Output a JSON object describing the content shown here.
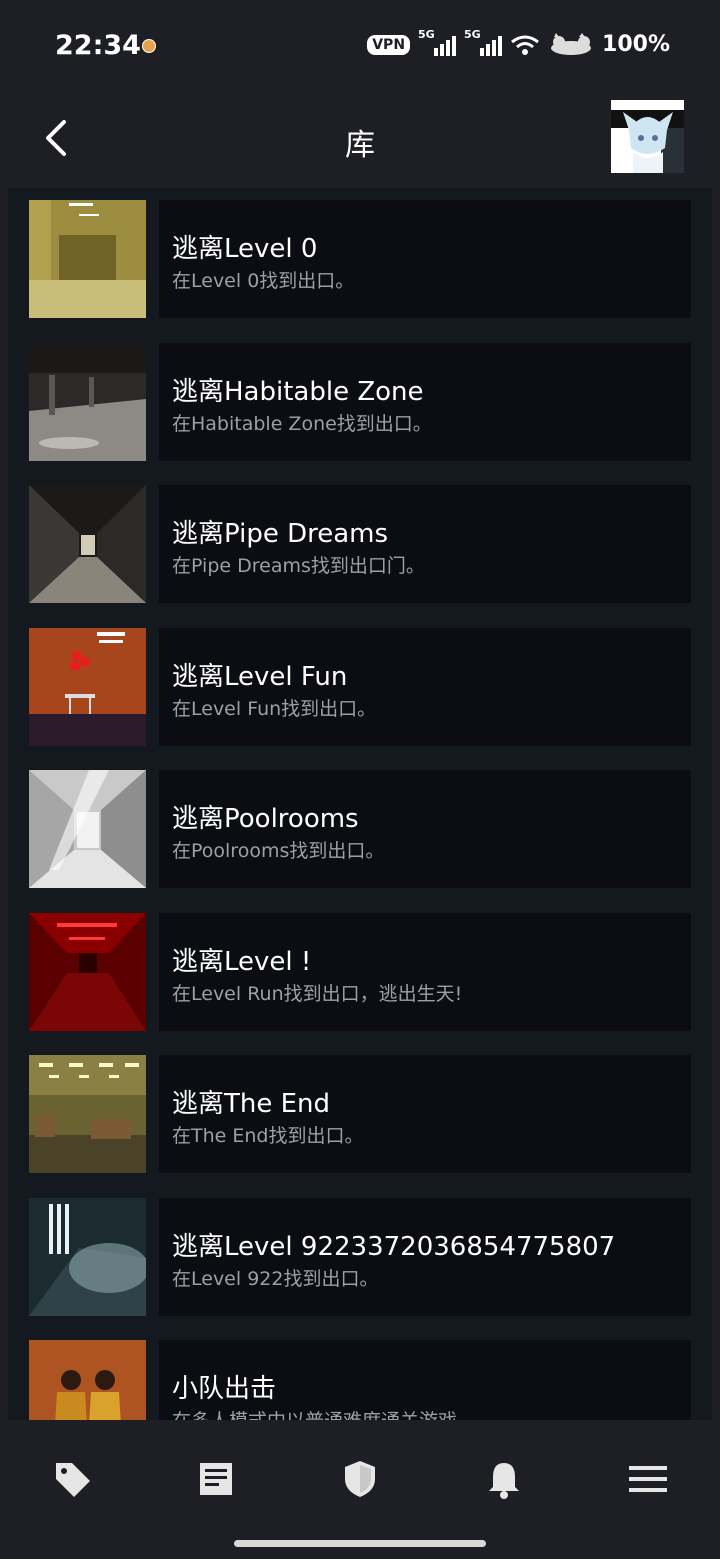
{
  "status_bar": {
    "time": "22:34",
    "vpn": "VPN",
    "network1": "5G",
    "network2": "5G",
    "battery": "100%"
  },
  "header": {
    "title": "库"
  },
  "achievements": [
    {
      "title": "逃离Level 0",
      "desc": "在Level 0找到出口。"
    },
    {
      "title": "逃离Habitable Zone",
      "desc": "在Habitable Zone找到出口。"
    },
    {
      "title": "逃离Pipe Dreams",
      "desc": "在Pipe Dreams找到出口门。"
    },
    {
      "title": "逃离Level Fun",
      "desc": "在Level Fun找到出口。"
    },
    {
      "title": "逃离Poolrooms",
      "desc": "在Poolrooms找到出口。"
    },
    {
      "title": "逃离Level !",
      "desc": "在Level Run找到出口，逃出生天!"
    },
    {
      "title": "逃离The End",
      "desc": "在The End找到出口。"
    },
    {
      "title": "逃离Level 9223372036854775807",
      "desc": "在Level 922找到出口。"
    },
    {
      "title": "小队出击",
      "desc": "在多人模式中以普通难度通关游戏"
    }
  ],
  "bottom_nav": {
    "icons": [
      "tag-icon",
      "news-icon",
      "shield-icon",
      "bell-icon",
      "menu-icon"
    ]
  },
  "colors": {
    "background": "#1d1f25",
    "list_background": "#14191f",
    "card_background": "#0b0d12",
    "title_text": "#ffffff",
    "desc_text": "#9aa0a8"
  }
}
